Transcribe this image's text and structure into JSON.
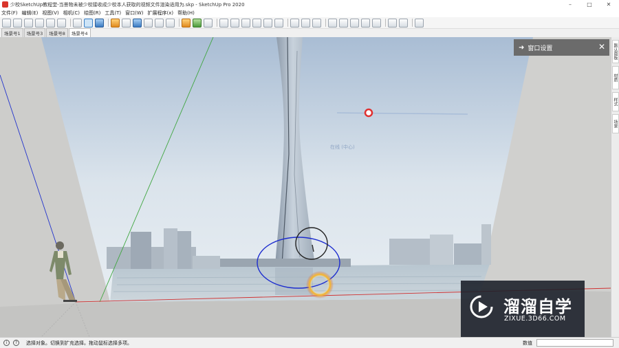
{
  "window": {
    "title": "少校SketchUp教程堂-当景物未被少校接收成少校本人获取的视频文件渲染适用为.skp - SketchUp Pro 2020",
    "minimize": "–",
    "maximize": "□",
    "close": "✕"
  },
  "menu": {
    "items": [
      "文件(F)",
      "编辑(E)",
      "视图(V)",
      "相机(C)",
      "绘图(R)",
      "工具(T)",
      "窗口(W)",
      "扩展程序(x)",
      "帮助(H)"
    ]
  },
  "scenes": {
    "tabs": [
      "场景号1",
      "场景号3",
      "场景号8",
      "场景号4"
    ],
    "active_index": 3
  },
  "tray": {
    "title": "窗口设置",
    "arrow": "➜",
    "close": "✕"
  },
  "right_strip": {
    "tabs": [
      "默认面板",
      "材质",
      "样式",
      "场景"
    ]
  },
  "viewport": {
    "inference_label": "在线 (中心)"
  },
  "status": {
    "geo_icon": "i",
    "info_icon": "?",
    "text": "选择对象。切换到扩充选择。拖动鼠标选择多项。",
    "measure_label": "数值",
    "measure_value": ""
  },
  "watermark": {
    "name": "溜溜自学",
    "url": "ZIXUE.3D66.COM"
  },
  "colors": {
    "tray_header": "#6b6b6b",
    "sky": "#c9d6e4",
    "green_axis": "#3fa63f",
    "blue_axis": "#2233cc",
    "red_axis": "#d03030"
  }
}
